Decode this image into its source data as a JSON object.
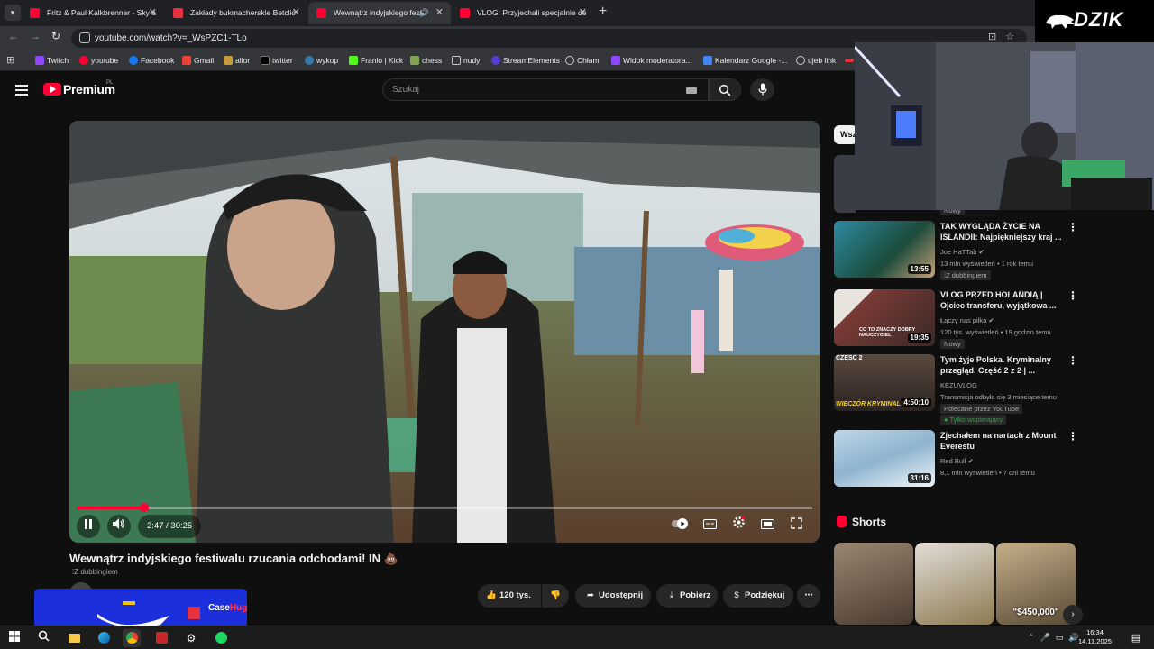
{
  "browser": {
    "tabs": [
      {
        "title": "Fritz & Paul Kalkbrenner - Sky a",
        "active": false
      },
      {
        "title": "Zakłady bukmacherskie Betclic",
        "active": false
      },
      {
        "title": "Wewnątrz indyjskiego festi",
        "active": true
      },
      {
        "title": "VLOG: Przyjechali specjalnie do",
        "active": false
      }
    ],
    "url": "youtube.com/watch?v=_WsPZC1-TLo",
    "bookmarks": [
      "Twitch",
      "youtube",
      "Facebook",
      "Gmail",
      "alior",
      "twitter",
      "wykop",
      "Franio | Kick",
      "chess",
      "nudy",
      "StreamElements",
      "Chłam",
      "Widok moderatora...",
      "Kalendarz Google -...",
      "ujeb link"
    ]
  },
  "youtube": {
    "logo": "Premium",
    "region": "PL",
    "search_placeholder": "Szukaj"
  },
  "player": {
    "time": "2:47 / 30:25",
    "progress": 0.092
  },
  "video": {
    "title": "Wewnątrz indyjskiego festiwalu rzucania odchodami! IN 💩",
    "dubbing": "Z dubbingiem",
    "likes": "120 tys.",
    "share": "Udostępnij",
    "download": "Pobierz",
    "thanks": "Podziękuj"
  },
  "sidebar": {
    "chip": "Wsz",
    "partial_badge": "Nowy",
    "recommendations": [
      {
        "title": "TAK WYGLĄDA ŻYCIE NA ISLANDII: Najpiękniejszy kraj ...",
        "channel": "Joe HaTTab",
        "meta": "13 mln wyświetleń • 1 rok temu",
        "badge": "Z dubbingiem",
        "badge2": "",
        "duration": "13:55",
        "color": "#2f7d8c"
      },
      {
        "title": "VLOG PRZED HOLANDIĄ | Ojciec transferu, wyjątkowa ...",
        "channel": "Łączy nas piłka",
        "meta": "120 tys. wyświetleń • 19 godzin temu",
        "badge": "Nowy",
        "badge2": "",
        "duration": "19:35",
        "thumb_text": "CO TO ZNACZY DOBRY NAUCZYCIEL",
        "color": "#6e3330"
      },
      {
        "title": "Tym żyje Polska. Kryminalny przegląd. Część 2 z 2 | ...",
        "channel": "KEZUVLOG",
        "meta": "Transmisja odbyła się 3 miesiące temu",
        "badge": "Polecane przez YouTube",
        "badge2": "Tylko wspierający",
        "duration": "4:50:10",
        "thumb_text": "WIECZÓR KRYMINALNY",
        "thumb_top": "CZĘŚĆ 2",
        "color": "#4a3a30"
      },
      {
        "title": "Zjechałem na nartach z Mount Everestu",
        "channel": "Red Bull",
        "meta": "8,1 mln wyświetleń • 7 dni temu",
        "badge": "",
        "badge2": "",
        "duration": "31:16",
        "color": "#9fc3dc"
      }
    ],
    "shorts_title": "Shorts",
    "shorts": [
      {
        "caption": "",
        "color": "#6b5a4a"
      },
      {
        "caption": "",
        "color": "#c9c4bd"
      },
      {
        "caption": "\"$450,000\"",
        "color": "#b9a27a"
      }
    ]
  },
  "overlay": {
    "brand": "DZIK",
    "case_brand_a": "Case",
    "case_brand_b": "Hug"
  },
  "taskbar": {
    "time": "16:34",
    "date": "14.11.2025"
  }
}
